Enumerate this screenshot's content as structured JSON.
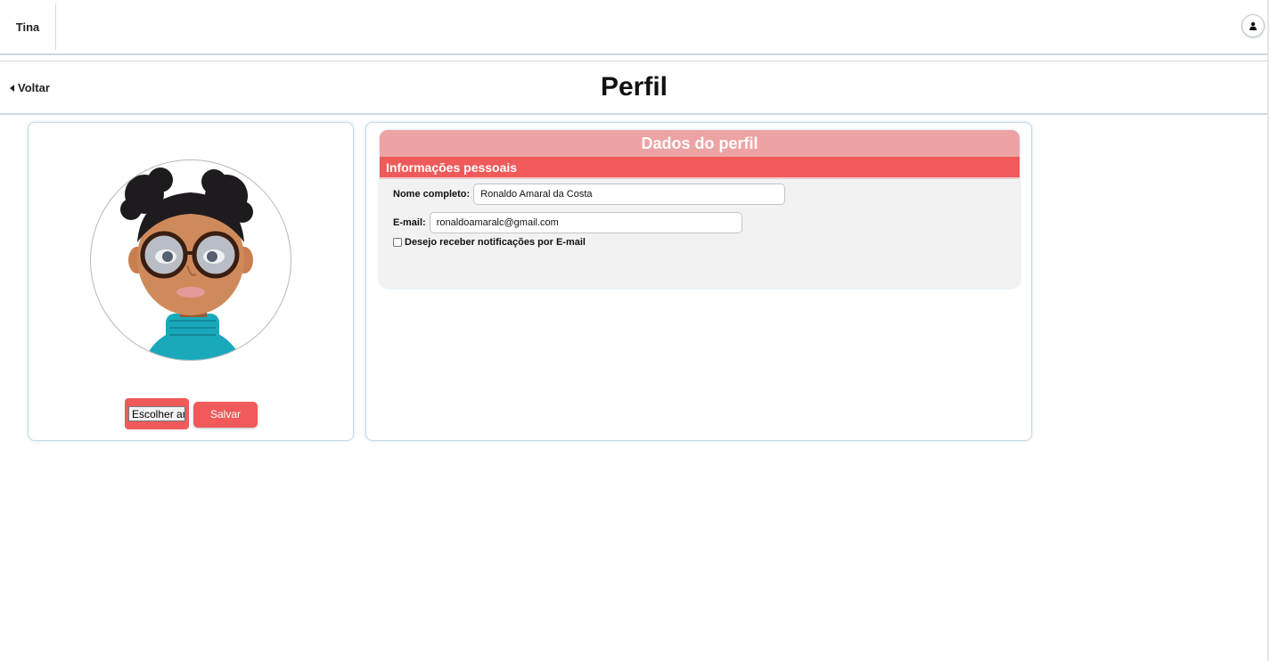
{
  "topbar": {
    "brand": "Tina",
    "user_icon": "user-icon"
  },
  "header": {
    "back_label": "Voltar",
    "back_icon": "caret-left-icon",
    "title": "Perfil"
  },
  "avatar_card": {
    "file_button_label": "Escolher ar",
    "save_label": "Salvar"
  },
  "profile": {
    "title": "Dados do perfil",
    "section": "Informações pessoais",
    "name_label": "Nome completo:",
    "name_value": "Ronaldo Amaral da Costa",
    "email_label": "E-mail:",
    "email_value": "ronaldoamaralc@gmail.com",
    "notify_label": "Desejo receber notificações por E-mail",
    "notify_checked": false
  },
  "colors": {
    "accent": "#f05a5a",
    "accent_light": "#eda3a3",
    "panel_bg": "#f2f2f2"
  }
}
